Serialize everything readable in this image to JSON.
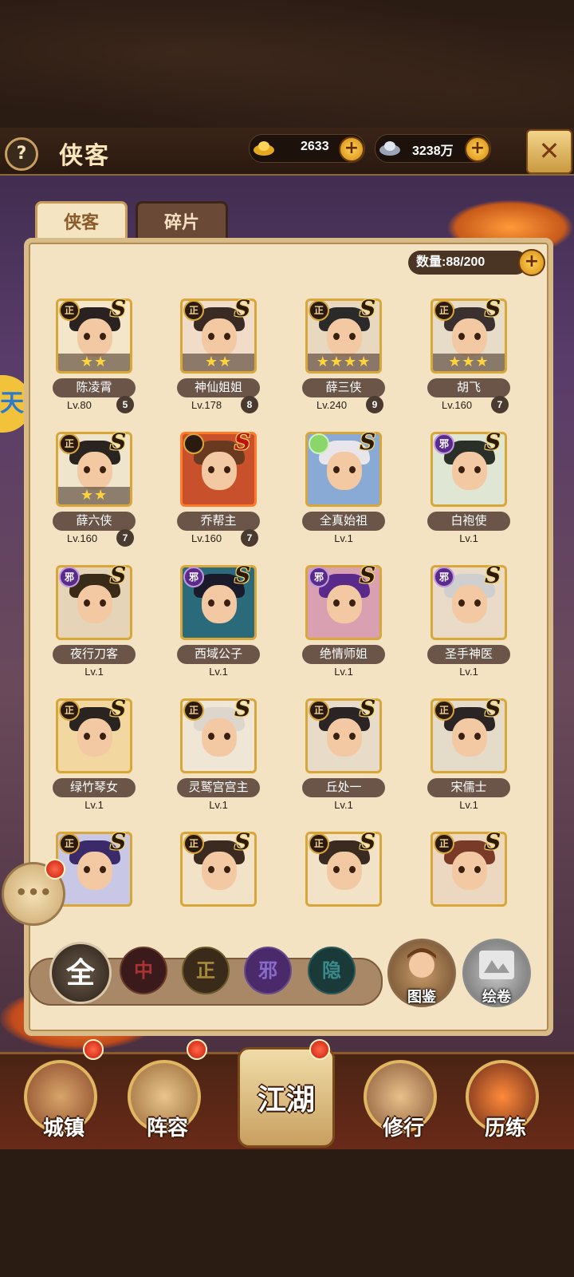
{
  "header": {
    "help": "?",
    "title": "侠客",
    "close": "✕"
  },
  "currency": {
    "gold": "2633",
    "silver": "3238万"
  },
  "tabs": [
    "侠客",
    "碎片"
  ],
  "capacity": "数量:88/200",
  "heroes": [
    {
      "name": "陈凌霄",
      "level": "Lv.80",
      "dup": "5",
      "faction": "正",
      "grade": "S",
      "stars": "★★"
    },
    {
      "name": "神仙姐姐",
      "level": "Lv.178",
      "dup": "8",
      "faction": "正",
      "grade": "S",
      "stars": "★★"
    },
    {
      "name": "薛三侠",
      "level": "Lv.240",
      "dup": "9",
      "faction": "正",
      "grade": "S",
      "stars": "★★★★"
    },
    {
      "name": "胡飞",
      "level": "Lv.160",
      "dup": "7",
      "faction": "正",
      "grade": "S",
      "stars": "★★★"
    },
    {
      "name": "薛六侠",
      "level": "Lv.160",
      "dup": "7",
      "faction": "正",
      "grade": "S",
      "stars": "★★"
    },
    {
      "name": "乔帮主",
      "level": "Lv.160",
      "dup": "7",
      "faction": "",
      "grade": "S",
      "stars": ""
    },
    {
      "name": "全真始祖",
      "level": "Lv.1",
      "dup": "",
      "faction": "",
      "grade": "S",
      "stars": ""
    },
    {
      "name": "白袍使",
      "level": "Lv.1",
      "dup": "",
      "faction": "邪",
      "grade": "S",
      "stars": ""
    },
    {
      "name": "夜行刀客",
      "level": "Lv.1",
      "dup": "",
      "faction": "邪",
      "grade": "S",
      "stars": ""
    },
    {
      "name": "西域公子",
      "level": "Lv.1",
      "dup": "",
      "faction": "邪",
      "grade": "S",
      "stars": ""
    },
    {
      "name": "绝情师姐",
      "level": "Lv.1",
      "dup": "",
      "faction": "邪",
      "grade": "S",
      "stars": ""
    },
    {
      "name": "圣手神医",
      "level": "Lv.1",
      "dup": "",
      "faction": "邪",
      "grade": "S",
      "stars": ""
    },
    {
      "name": "绿竹琴女",
      "level": "Lv.1",
      "dup": "",
      "faction": "正",
      "grade": "S",
      "stars": ""
    },
    {
      "name": "灵鹫宫宫主",
      "level": "Lv.1",
      "dup": "",
      "faction": "正",
      "grade": "S",
      "stars": ""
    },
    {
      "name": "丘处一",
      "level": "Lv.1",
      "dup": "",
      "faction": "正",
      "grade": "S",
      "stars": ""
    },
    {
      "name": "宋儒士",
      "level": "Lv.1",
      "dup": "",
      "faction": "正",
      "grade": "S",
      "stars": ""
    },
    {
      "name": "",
      "level": "",
      "dup": "",
      "faction": "正",
      "grade": "S",
      "stars": ""
    },
    {
      "name": "",
      "level": "",
      "dup": "",
      "faction": "正",
      "grade": "S",
      "stars": ""
    },
    {
      "name": "",
      "level": "",
      "dup": "",
      "faction": "正",
      "grade": "S",
      "stars": ""
    },
    {
      "name": "",
      "level": "",
      "dup": "",
      "faction": "正",
      "grade": "S",
      "stars": ""
    }
  ],
  "filters": {
    "all": "全",
    "zhong": "中",
    "zheng": "正",
    "xie": "邪",
    "yin": "隐"
  },
  "gallery": {
    "tujian": "图鉴",
    "huijuan": "绘卷"
  },
  "chat": "•••",
  "nav": {
    "town": "城镇",
    "lineup": "阵容",
    "jianghu": "江湖",
    "practice": "修行",
    "trial": "历练"
  },
  "sidepeek": "天"
}
